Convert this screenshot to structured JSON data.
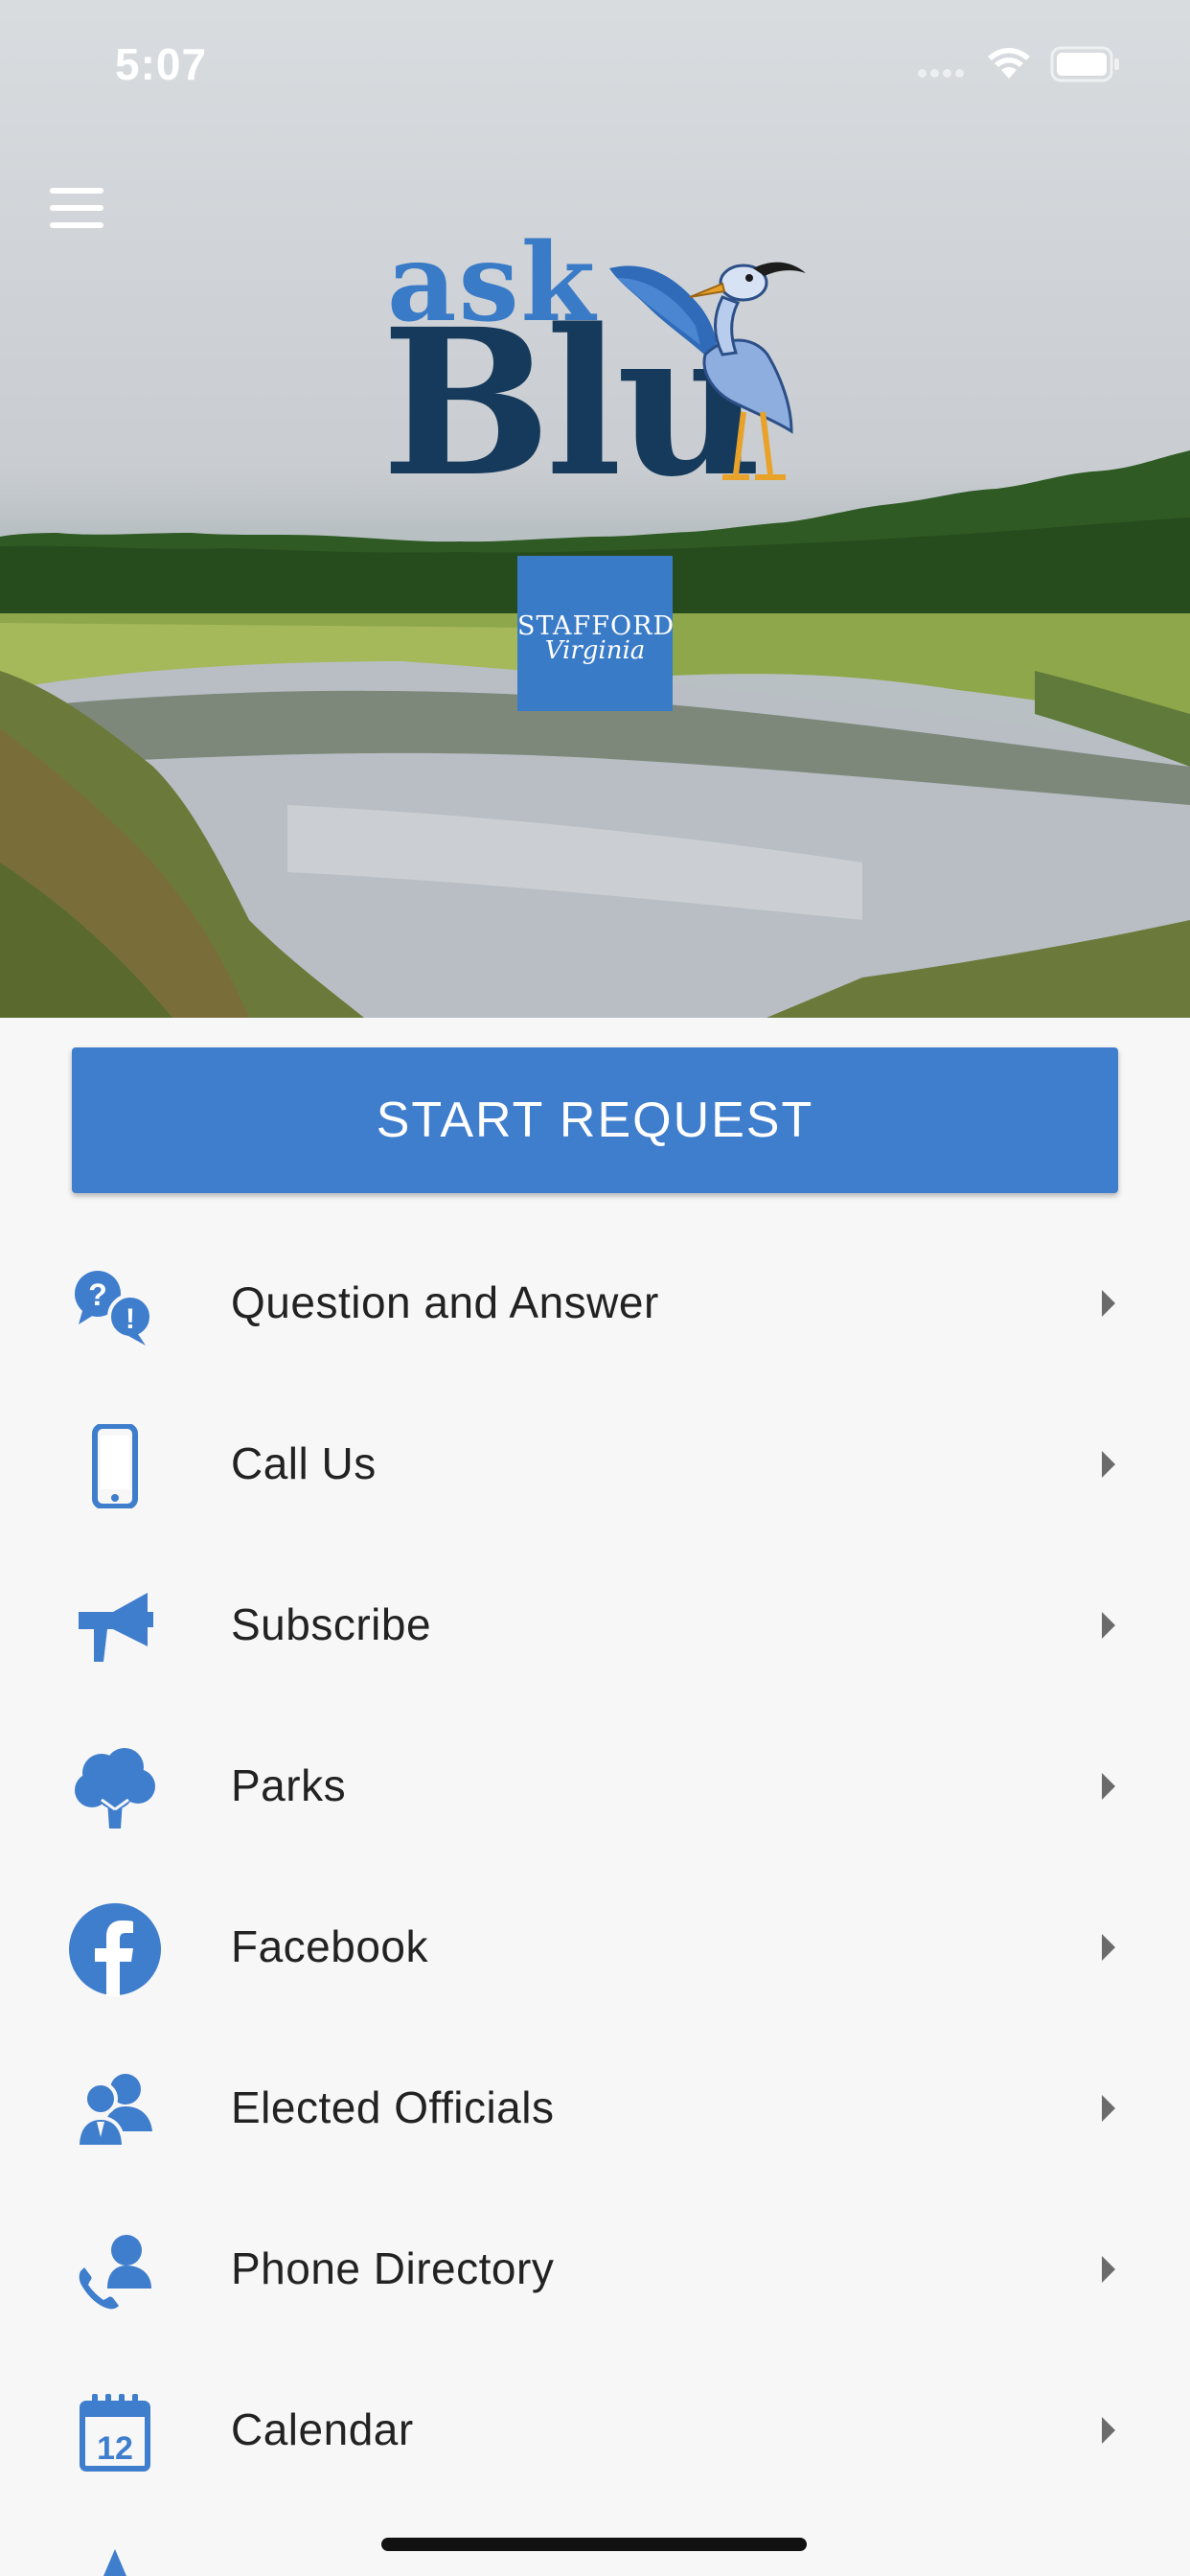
{
  "status_bar": {
    "time": "5:07",
    "icons": [
      "cellular-dots-icon",
      "wifi-icon",
      "battery-icon"
    ]
  },
  "header": {
    "menu_icon": "hamburger-menu-icon",
    "logo": {
      "word_top": "ask",
      "word_bottom": "Blu",
      "mascot": "heron-mascot-icon"
    },
    "badge": {
      "line1": "STAFFORD",
      "line2": "Virginia"
    }
  },
  "primary_action": {
    "label": "START REQUEST"
  },
  "menu_items": [
    {
      "label": "Question and Answer",
      "icon": "question-answer-icon"
    },
    {
      "label": "Call Us",
      "icon": "mobile-phone-icon"
    },
    {
      "label": "Subscribe",
      "icon": "megaphone-icon"
    },
    {
      "label": "Parks",
      "icon": "tree-icon"
    },
    {
      "label": "Facebook",
      "icon": "facebook-icon"
    },
    {
      "label": "Elected Officials",
      "icon": "officials-icon"
    },
    {
      "label": "Phone Directory",
      "icon": "phone-directory-icon"
    },
    {
      "label": "Calendar",
      "icon": "calendar-icon",
      "calendar_day": "12"
    }
  ],
  "colors": {
    "accent": "#3f7dcd",
    "logo_dark": "#163a5c",
    "logo_light": "#3a7bc8",
    "background": "#f7f7f7",
    "text": "#222222"
  }
}
